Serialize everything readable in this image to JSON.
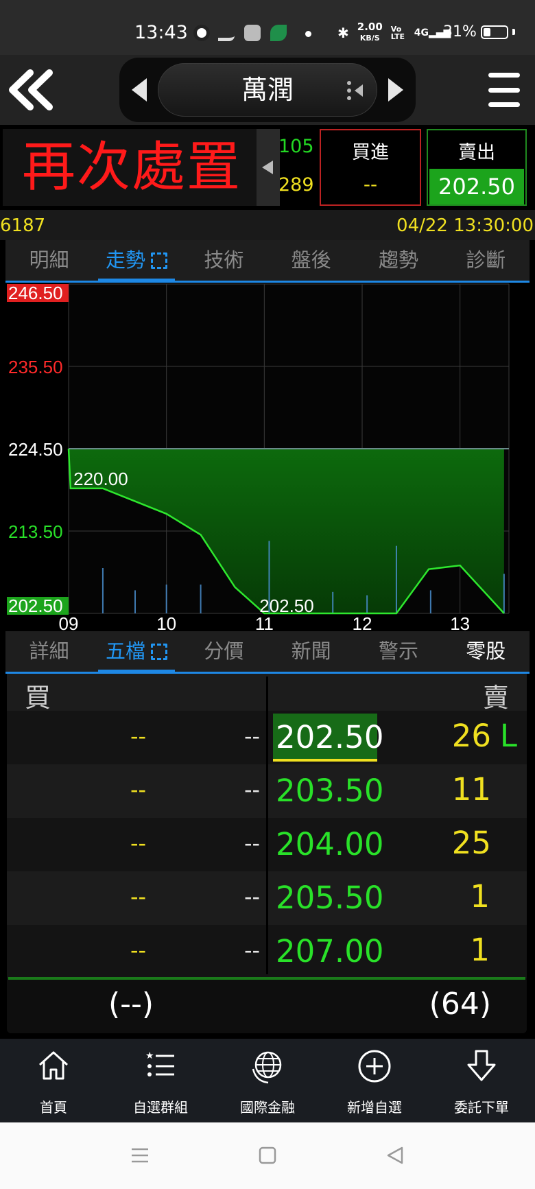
{
  "status_bar": {
    "time": "13:43",
    "net_speed_value": "2.00",
    "net_speed_unit": "KB/S",
    "volte": "Vo LTE",
    "network": "4G",
    "battery": "31%",
    "battery_level": 0.31
  },
  "header": {
    "title": "萬潤"
  },
  "quote": {
    "halt_text": "再次處置",
    "vol_top": "105",
    "vol_bottom": "289",
    "buy_label": "買進",
    "buy_value": "--",
    "sell_label": "賣出",
    "sell_value": "202.50"
  },
  "info": {
    "code": "6187",
    "datetime": "04/22 13:30:00"
  },
  "tabs_top": [
    "明細",
    "走勢",
    "技術",
    "盤後",
    "趨勢",
    "診斷"
  ],
  "tabs_bottom": [
    "詳細",
    "五檔",
    "分價",
    "新聞",
    "警示",
    "零股"
  ],
  "chart_data": {
    "type": "area",
    "y_ticks": [
      "246.50",
      "235.50",
      "224.50",
      "213.50",
      "202.50"
    ],
    "ylim": [
      202.5,
      246.5
    ],
    "reference_price": 224.5,
    "x_ticks": [
      "09",
      "10",
      "11",
      "12",
      "13"
    ],
    "x_range_hours": [
      9.0,
      13.5
    ],
    "price_line": {
      "x": [
        9.0,
        9.02,
        9.35,
        10.0,
        10.35,
        10.7,
        11.0,
        11.5,
        12.0,
        12.35,
        12.68,
        13.0,
        13.45
      ],
      "y": [
        224.5,
        219.2,
        219.2,
        215.8,
        213.0,
        206.0,
        202.5,
        202.5,
        202.5,
        202.5,
        208.4,
        208.9,
        202.5
      ]
    },
    "annotations": [
      {
        "text": "220.00",
        "x": 9.05,
        "y": 220.0
      },
      {
        "text": "202.50",
        "x": 10.95,
        "y": 202.5
      }
    ],
    "volume_bars": {
      "x": [
        9.35,
        9.68,
        10.0,
        10.35,
        11.05,
        11.7,
        12.05,
        12.35,
        12.7,
        13.45
      ],
      "v": [
        0.55,
        0.28,
        0.35,
        0.35,
        0.88,
        0.26,
        0.22,
        0.82,
        0.28,
        0.48
      ]
    },
    "grid": true,
    "colors": {
      "line": "#2ee82e",
      "fill": "#0c5a0c",
      "grid": "#3a3a3a",
      "up": "#ff2a2a",
      "down": "#29e129",
      "flat": "#ffffff",
      "volume": "#4a8fd0"
    }
  },
  "order_book": {
    "buy_header": "買",
    "sell_header": "賣",
    "rows": [
      {
        "buy_qty": "--",
        "buy_price": "--",
        "ask_price": "202.50",
        "ask_qty": "26",
        "flag": "L"
      },
      {
        "buy_qty": "--",
        "buy_price": "--",
        "ask_price": "203.50",
        "ask_qty": "11",
        "flag": ""
      },
      {
        "buy_qty": "--",
        "buy_price": "--",
        "ask_price": "204.00",
        "ask_qty": "25",
        "flag": ""
      },
      {
        "buy_qty": "--",
        "buy_price": "--",
        "ask_price": "205.50",
        "ask_qty": "1",
        "flag": ""
      },
      {
        "buy_qty": "--",
        "buy_price": "--",
        "ask_price": "207.00",
        "ask_qty": "1",
        "flag": ""
      }
    ],
    "buy_total": "(--)",
    "sell_total": "(64)"
  },
  "bottom_nav": [
    {
      "label": "首頁",
      "icon": "home-icon"
    },
    {
      "label": "自選群組",
      "icon": "list-icon"
    },
    {
      "label": "國際金融",
      "icon": "globe-icon"
    },
    {
      "label": "新增自選",
      "icon": "add-circle-icon"
    },
    {
      "label": "委託下單",
      "icon": "order-arrow-icon"
    }
  ]
}
